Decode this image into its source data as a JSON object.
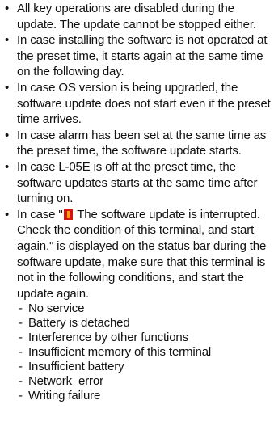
{
  "bullets": [
    "All key operations are disabled during the update. The update cannot be stopped either.",
    "In case installing the software is not operated at the preset time, it starts again at the same time on the following day.",
    "In case OS version is being upgraded, the software update does not start even if the preset time arrives.",
    "In case alarm has been set at the same time as the preset time, the software update starts.",
    "In case L-05E is off at the preset time, the software updates starts at the same time after turning on."
  ],
  "interrupt_bullet": {
    "before_icon": "In case \"",
    "icon": "warning-icon",
    "after_icon": " The software update is interrupted. Check the condition of this terminal, and start again.\" is displayed on the status bar during the software update, make sure that this terminal is not in the following conditions, and start the update again."
  },
  "conditions": [
    "No service",
    "Battery is detached",
    "Interference by other functions",
    "Insufficient memory of this terminal",
    "Insufficient battery",
    "Network  error",
    "Writing failure"
  ],
  "colors": {
    "icon_bg": "#d4140f",
    "icon_mark": "#f7a400"
  }
}
